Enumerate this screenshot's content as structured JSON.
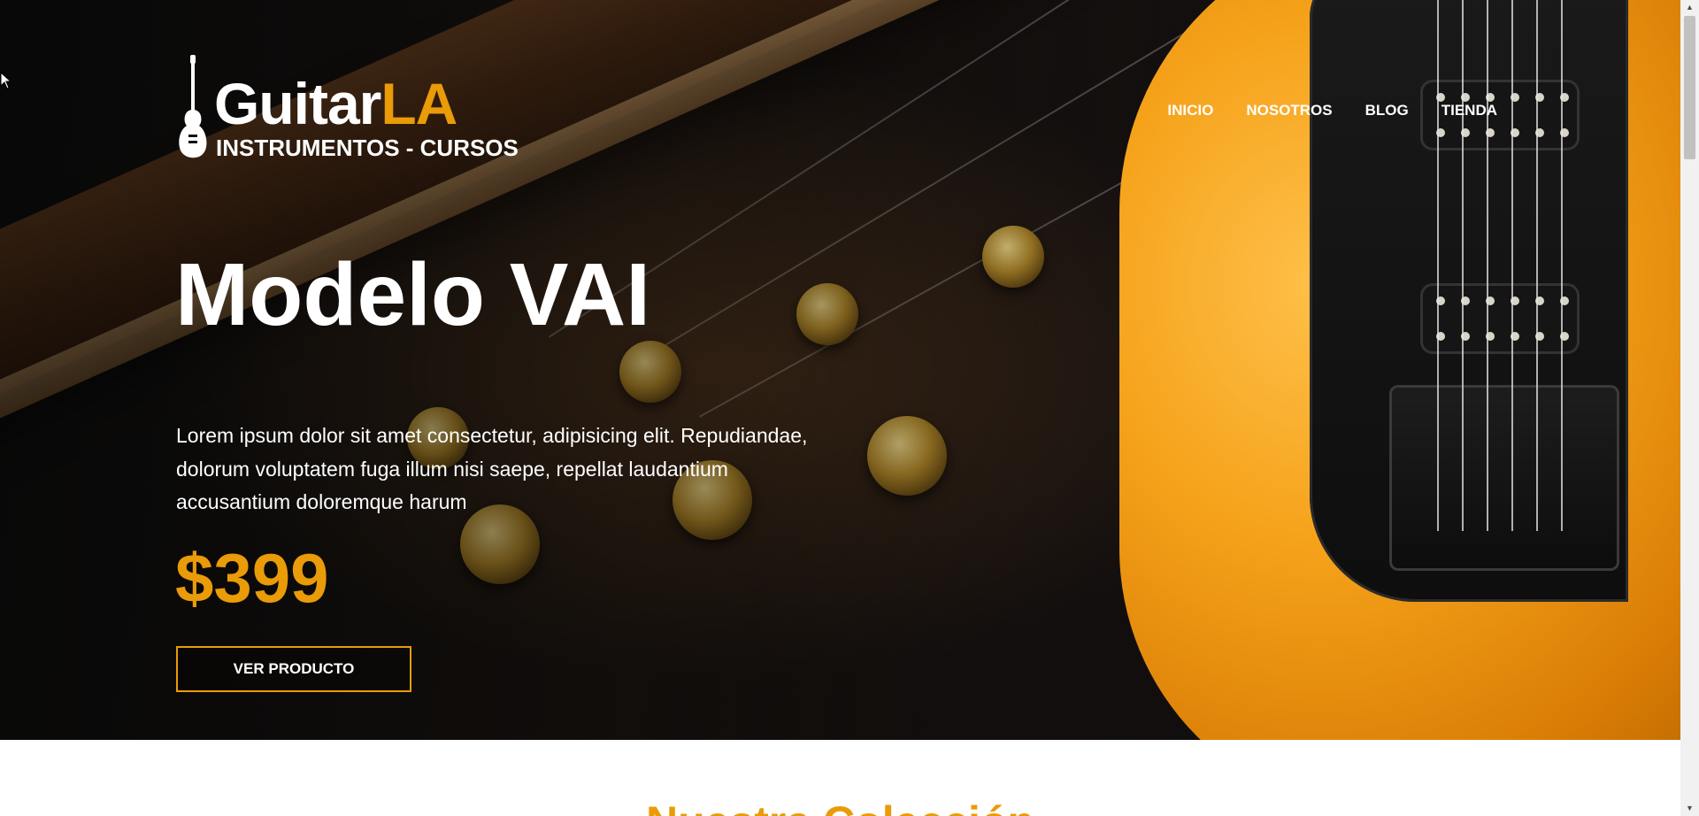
{
  "header": {
    "logo": {
      "brand_main": "Guitar",
      "brand_accent": "LA",
      "tagline": "INSTRUMENTOS - CURSOS",
      "icon": "guitar-icon"
    },
    "nav": {
      "items": [
        {
          "label": "INICIO"
        },
        {
          "label": "NOSOTROS"
        },
        {
          "label": "BLOG"
        },
        {
          "label": "TIENDA"
        }
      ]
    }
  },
  "hero": {
    "title": "Modelo VAI",
    "description": "Lorem ipsum dolor sit amet consectetur, adipisicing elit. Repudiandae, dolorum voluptatem fuga illum nisi saepe, repellat laudantium accusantium doloremque harum",
    "price": "$399",
    "cta_label": "VER PRODUCTO"
  },
  "next_section": {
    "title": "Nuestra Colección"
  },
  "colors": {
    "accent": "#e99b08",
    "text_light": "#ffffff",
    "background_dark": "#121212"
  },
  "scrollbar": {
    "up_icon": "arrow-up-icon",
    "down_icon": "arrow-down-icon"
  }
}
